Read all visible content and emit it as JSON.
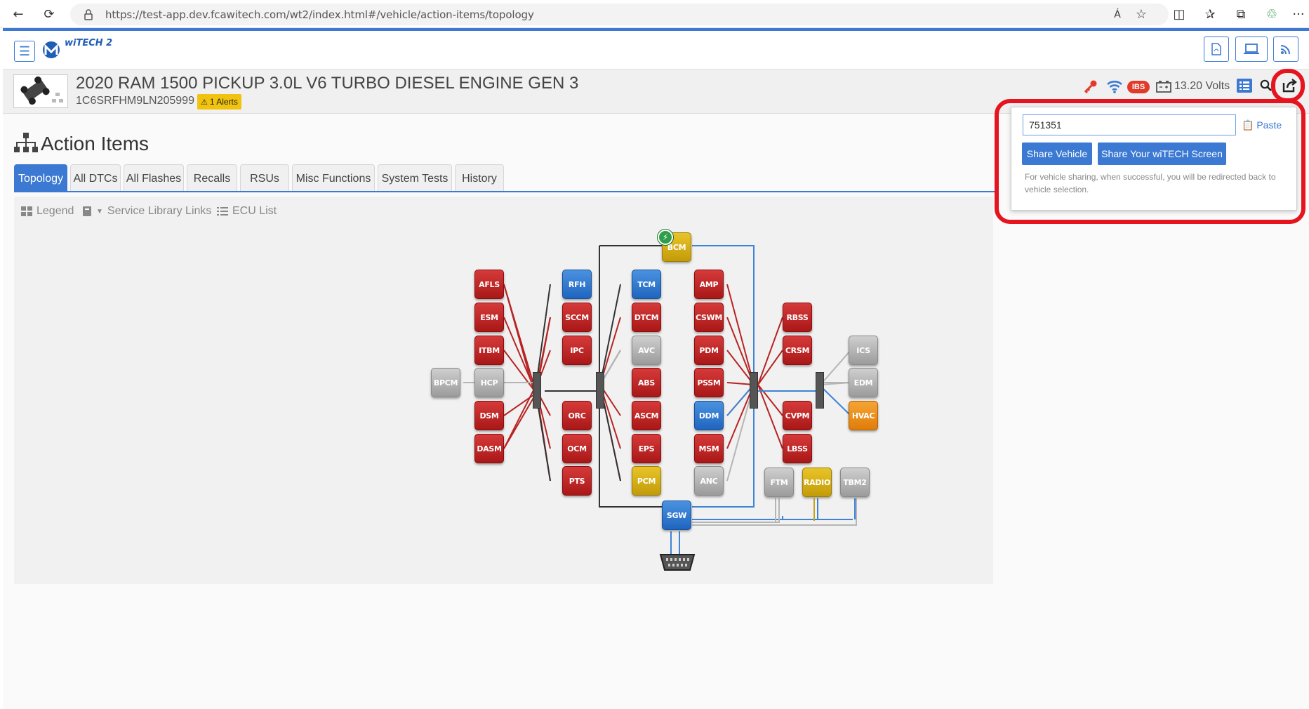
{
  "browser": {
    "url": "https://test-app.dev.fcawitech.com/wt2/index.html#/vehicle/action-items/topology",
    "back_icon": "←",
    "refresh_icon": "⟳",
    "lock_icon": "🔒",
    "read_aloud_icon": "Á",
    "star_icon": "☆",
    "split_icon": "◫",
    "favorites_icon": "✰",
    "collections_icon": "⧉",
    "extensions_icon": "♲",
    "menu_icon": "···"
  },
  "app": {
    "logo_text": "wiTECH 2",
    "menu_icon": "☰"
  },
  "vehicle": {
    "title": "2020 RAM 1500 PICKUP 3.0L V6 TURBO DIESEL ENGINE GEN 3",
    "vin": "1C6SRFHM9LN205999",
    "alerts": "1 Alerts",
    "ibs": "IBS",
    "volts": "13.20 Volts"
  },
  "page": {
    "title": "Action Items"
  },
  "tabs": [
    {
      "label": "Topology",
      "active": true
    },
    {
      "label": "All DTCs"
    },
    {
      "label": "All Flashes"
    },
    {
      "label": "Recalls"
    },
    {
      "label": "RSUs"
    },
    {
      "label": "Misc Functions"
    },
    {
      "label": "System Tests"
    },
    {
      "label": "History"
    }
  ],
  "tools": {
    "legend": "Legend",
    "service_library": "Service Library Links",
    "ecu_list": "ECU List"
  },
  "modules": {
    "BCM": "BCM",
    "AFLS": "AFLS",
    "ESM": "ESM",
    "ITBM": "ITBM",
    "BPCM": "BPCM",
    "HCP": "HCP",
    "DSM": "DSM",
    "DASM": "DASM",
    "RFH": "RFH",
    "SCCM": "SCCM",
    "IPC": "IPC",
    "ORC": "ORC",
    "OCM": "OCM",
    "PTS": "PTS",
    "TCM": "TCM",
    "DTCM": "DTCM",
    "AVC": "AVC",
    "ABS": "ABS",
    "ASCM": "ASCM",
    "EPS": "EPS",
    "PCM": "PCM",
    "AMP": "AMP",
    "CSWM": "CSWM",
    "PDM": "PDM",
    "PSSM": "PSSM",
    "DDM": "DDM",
    "MSM": "MSM",
    "ANC": "ANC",
    "RBSS": "RBSS",
    "CRSM": "CRSM",
    "CVPM": "CVPM",
    "LBSS": "LBSS",
    "ICS": "ICS",
    "EDM": "EDM",
    "HVAC": "HVAC",
    "FTM": "FTM",
    "RADIO": "RADIO",
    "TBM2": "TBM2",
    "SGW": "SGW"
  },
  "share": {
    "input_value": "751351",
    "paste": "Paste",
    "share_vehicle": "Share Vehicle",
    "share_screen": "Share Your wiTECH Screen",
    "note": "For vehicle sharing, when successful, you will be redirected back to vehicle selection."
  },
  "colors": {
    "accent": "#3b79d3",
    "highlight_ring": "#e5141f",
    "module_red": "#c02525",
    "module_blue": "#2f79d0",
    "module_gray": "#b0b0b0",
    "module_yellow": "#d6b118",
    "module_orange": "#ee8f1e",
    "alert_yellow": "#f2c30e"
  }
}
